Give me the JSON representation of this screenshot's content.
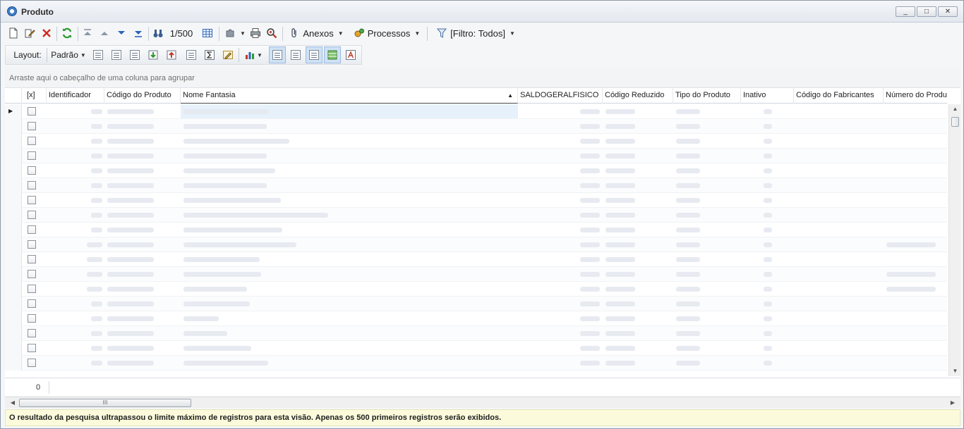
{
  "window": {
    "title": "Produto",
    "controls": [
      "_",
      "□",
      "✕"
    ]
  },
  "toolbar": {
    "record_position": "1/500",
    "attachments_label": "Anexos",
    "processes_label": "Processos",
    "filter_label": "[Filtro: Todos]"
  },
  "layout_bar": {
    "layout_label": "Layout:",
    "layout_value": "Padrão"
  },
  "group_hint": "Arraste aqui o cabeçalho de uma coluna para agrupar",
  "grid": {
    "columns": [
      "[x]",
      "Identificador",
      "Código do Produto",
      "Nome Fantasia",
      "SALDOGERALFISICO",
      "Código Reduzido",
      "Tipo do Produto",
      "Inativo",
      "Código do Fabricantes",
      "Número do Produto n"
    ],
    "sorted_column": "Nome Fantasia",
    "sort_direction": "ascending",
    "visible_row_count": 18,
    "rows_are_blurred": true
  },
  "footer": {
    "count": "0"
  },
  "status_message": "O resultado da pesquisa ultrapassou o limite máximo de registros para esta visão. Apenas os 500 primeiros registros serão exibidos.",
  "colors": {
    "status_bg": "#fbfbdc",
    "selected_row": "#e6f1fb",
    "accent_blue": "#3d7fc9"
  }
}
